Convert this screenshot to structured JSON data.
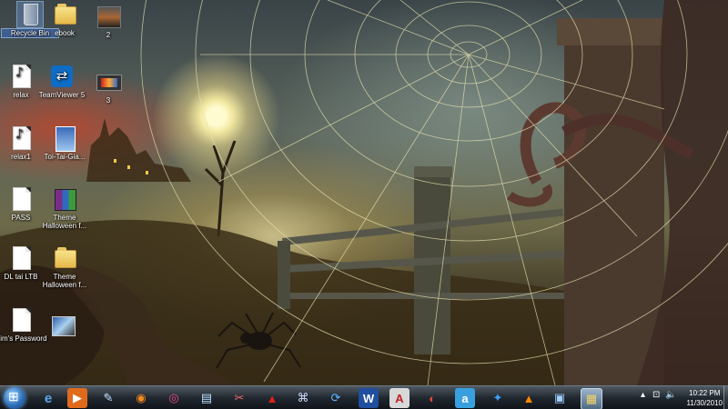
{
  "desktop": {
    "icons": [
      {
        "label": "Recycle Bin",
        "kind": "recycle-bin-icon"
      },
      {
        "label": "ebook",
        "kind": "folder-icon"
      },
      {
        "label": "2",
        "kind": "game-shortcut-icon"
      },
      {
        "label": "relax",
        "kind": "audio-file-icon"
      },
      {
        "label": "TeamViewer 5",
        "kind": "teamviewer-icon"
      },
      {
        "label": "3",
        "kind": "video-file-icon"
      },
      {
        "label": "relax1",
        "kind": "audio-file-icon"
      },
      {
        "label": "Toi-Tai-Gia...",
        "kind": "pdf-book-icon"
      },
      {
        "label": "PASS",
        "kind": "text-file-icon"
      },
      {
        "label": "Theme Halloween f...",
        "kind": "archive-icon"
      },
      {
        "label": "DL tai LTB",
        "kind": "text-file-icon"
      },
      {
        "label": "Theme Halloween f...",
        "kind": "folder-icon"
      },
      {
        "label": "Him's Password",
        "kind": "text-file-icon"
      },
      {
        "label": "",
        "kind": "image-shortcut-icon"
      }
    ]
  },
  "taskbar": {
    "pinned": [
      {
        "name": "internet-explorer-icon",
        "glyph": "e"
      },
      {
        "name": "media-player-icon",
        "glyph": "▶"
      },
      {
        "name": "paint-program-icon",
        "glyph": "✎"
      },
      {
        "name": "firefox-icon",
        "glyph": "◉"
      },
      {
        "name": "chrome-icon",
        "glyph": "◎"
      },
      {
        "name": "notepad-icon",
        "glyph": "▤"
      },
      {
        "name": "screen-capture-icon",
        "glyph": "✂"
      },
      {
        "name": "pdf-reader-icon",
        "glyph": "▲"
      },
      {
        "name": "network-icon",
        "glyph": "⌘"
      },
      {
        "name": "update-icon",
        "glyph": "⟳"
      },
      {
        "name": "word-icon",
        "glyph": "W"
      },
      {
        "name": "dictionary-icon",
        "glyph": "A"
      },
      {
        "name": "media-center-icon",
        "glyph": "◐"
      },
      {
        "name": "ameba-icon",
        "glyph": "a"
      },
      {
        "name": "messenger-icon",
        "glyph": "✦"
      },
      {
        "name": "vlc-icon",
        "glyph": "▲"
      },
      {
        "name": "remote-desktop-icon",
        "glyph": "▣"
      },
      {
        "name": "file-explorer-icon",
        "glyph": "▦"
      }
    ],
    "clock": {
      "time": "10:22 PM",
      "date": "11/30/2010"
    }
  }
}
